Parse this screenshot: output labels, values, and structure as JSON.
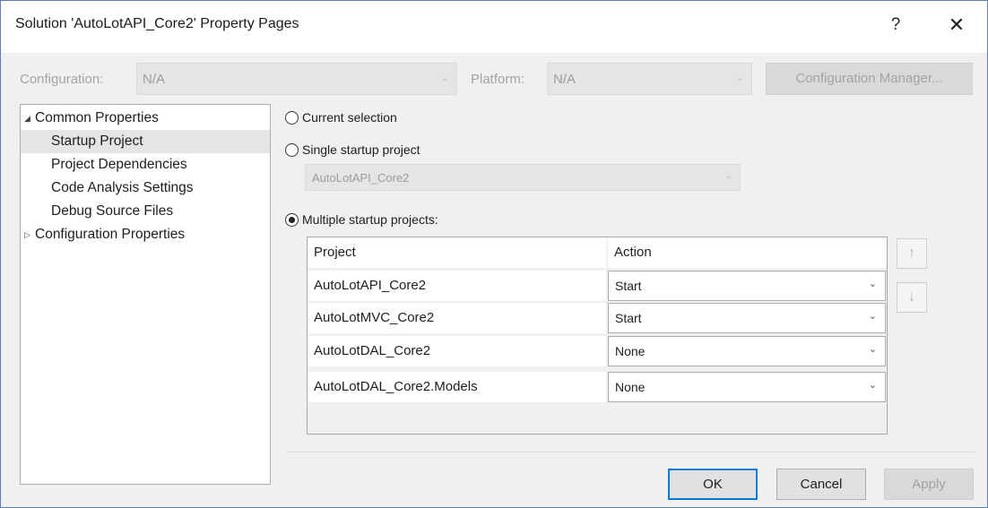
{
  "window": {
    "title": "Solution 'AutoLotAPI_Core2' Property Pages",
    "help_glyph": "?",
    "close_glyph": "✕"
  },
  "config_bar": {
    "configuration_label": "Configuration:",
    "configuration_value": "N/A",
    "platform_label": "Platform:",
    "platform_value": "N/A",
    "manager_button": "Configuration Manager..."
  },
  "tree": {
    "items": [
      {
        "label": "Common Properties",
        "arrow": "◢"
      },
      {
        "label": "Startup Project"
      },
      {
        "label": "Project Dependencies"
      },
      {
        "label": "Code Analysis Settings"
      },
      {
        "label": "Debug Source Files"
      },
      {
        "label": "Configuration Properties",
        "arrow": "▷"
      }
    ],
    "selected": "Startup Project"
  },
  "startup": {
    "current_selection": "Current selection",
    "single_startup": "Single startup project",
    "single_project_value": "AutoLotAPI_Core2",
    "multiple_startup": "Multiple startup projects:",
    "selected_option": "multiple"
  },
  "grid": {
    "col_project": "Project",
    "col_action": "Action",
    "rows": [
      {
        "project": "AutoLotAPI_Core2",
        "action": "Start"
      },
      {
        "project": "AutoLotMVC_Core2",
        "action": "Start"
      },
      {
        "project": "AutoLotDAL_Core2",
        "action": "None"
      },
      {
        "project": "AutoLotDAL_Core2.Models",
        "action": "None"
      }
    ]
  },
  "move": {
    "up_glyph": "↑",
    "down_glyph": "↓"
  },
  "buttons": {
    "ok": "OK",
    "cancel": "Cancel",
    "apply": "Apply"
  },
  "icons": {
    "chevron": "⌄"
  },
  "colors": {
    "accent": "#0078d7",
    "disabled_text": "#a3a3a3",
    "selection": "#e5e5e5"
  }
}
